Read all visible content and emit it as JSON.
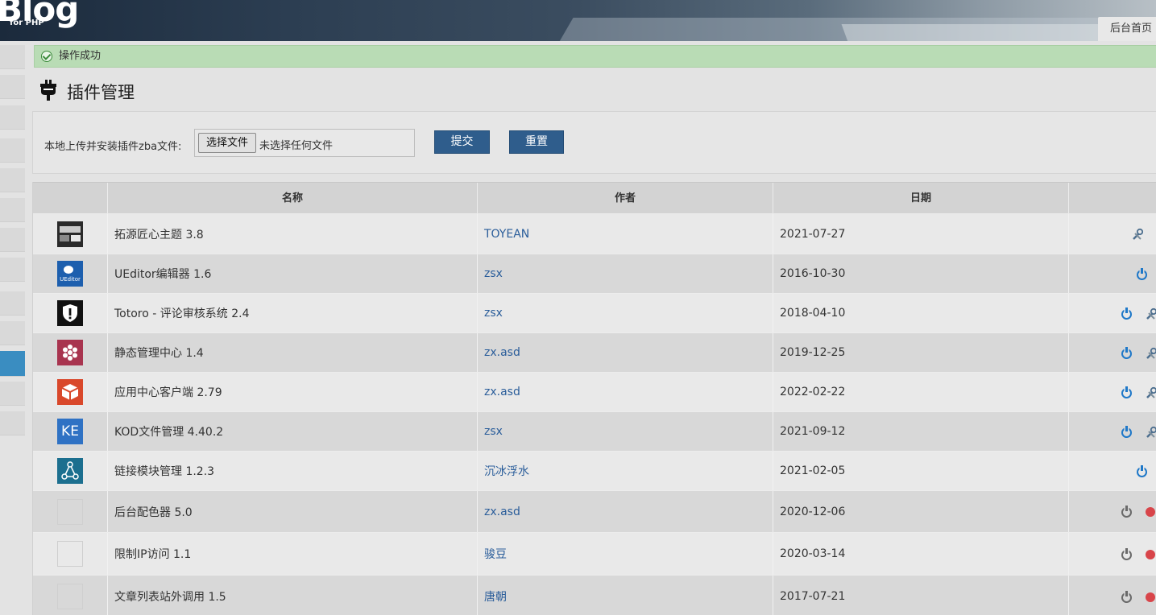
{
  "header": {
    "logo": "Blog",
    "logo_sub": "for PHP",
    "home_tab": "后台首页"
  },
  "notice": {
    "text": "操作成功"
  },
  "page": {
    "title": "插件管理"
  },
  "upload": {
    "label": "本地上传并安装插件zba文件:",
    "choose_button": "选择文件",
    "no_file_text": "未选择任何文件",
    "submit": "提交",
    "reset": "重置"
  },
  "table": {
    "columns": [
      "名称",
      "作者",
      "日期"
    ],
    "rows": [
      {
        "name": "拓源匠心主题 3.8",
        "author": "TOYEAN",
        "date": "2021-07-27",
        "icon": "toyean-theme-icon",
        "icon_color": "#2a2a2a",
        "actions": [
          "wrench"
        ]
      },
      {
        "name": "UEditor编辑器 1.6",
        "author": "zsx",
        "date": "2016-10-30",
        "icon": "ueditor-icon",
        "icon_color": "#1d5fae",
        "icon_text": "UEditor",
        "actions": [
          "power-on"
        ]
      },
      {
        "name": "Totoro - 评论审核系统 2.4",
        "author": "zsx",
        "date": "2018-04-10",
        "icon": "totoro-shield-icon",
        "icon_color": "#111111",
        "actions": [
          "power-on",
          "wrench"
        ]
      },
      {
        "name": "静态管理中心 1.4",
        "author": "zx.asd",
        "date": "2019-12-25",
        "icon": "static-manager-icon",
        "icon_color": "#a8344f",
        "actions": [
          "power-on",
          "wrench"
        ]
      },
      {
        "name": "应用中心客户端 2.79",
        "author": "zx.asd",
        "date": "2022-02-22",
        "icon": "app-center-icon",
        "icon_color": "#d9482b",
        "actions": [
          "power-on",
          "wrench"
        ]
      },
      {
        "name": "KOD文件管理 4.40.2",
        "author": "zsx",
        "date": "2021-09-12",
        "icon": "kod-file-icon",
        "icon_color": "#2f72c4",
        "icon_text": "KE",
        "actions": [
          "power-on",
          "wrench"
        ]
      },
      {
        "name": "链接模块管理 1.2.3",
        "author": "沉冰浮水",
        "date": "2021-02-05",
        "icon": "link-module-icon",
        "icon_color": "#1c6f8f",
        "actions": [
          "power-on"
        ]
      },
      {
        "name": "后台配色器 5.0",
        "author": "zx.asd",
        "date": "2020-12-06",
        "icon": "broken-image-icon",
        "actions": [
          "power-off",
          "delete"
        ]
      },
      {
        "name": "限制IP访问 1.1",
        "author": "骏豆",
        "date": "2020-03-14",
        "icon": "broken-image-icon",
        "actions": [
          "power-off",
          "delete"
        ]
      },
      {
        "name": "文章列表站外调用 1.5",
        "author": "唐朝",
        "date": "2017-07-21",
        "icon": "broken-image-icon",
        "actions": [
          "power-off",
          "delete"
        ]
      }
    ]
  },
  "colors": {
    "accent": "#2f5d8c",
    "success_bg": "#b9dcb5",
    "sidebar_active": "#3a8dc1",
    "author_link": "#2a5d9a"
  }
}
